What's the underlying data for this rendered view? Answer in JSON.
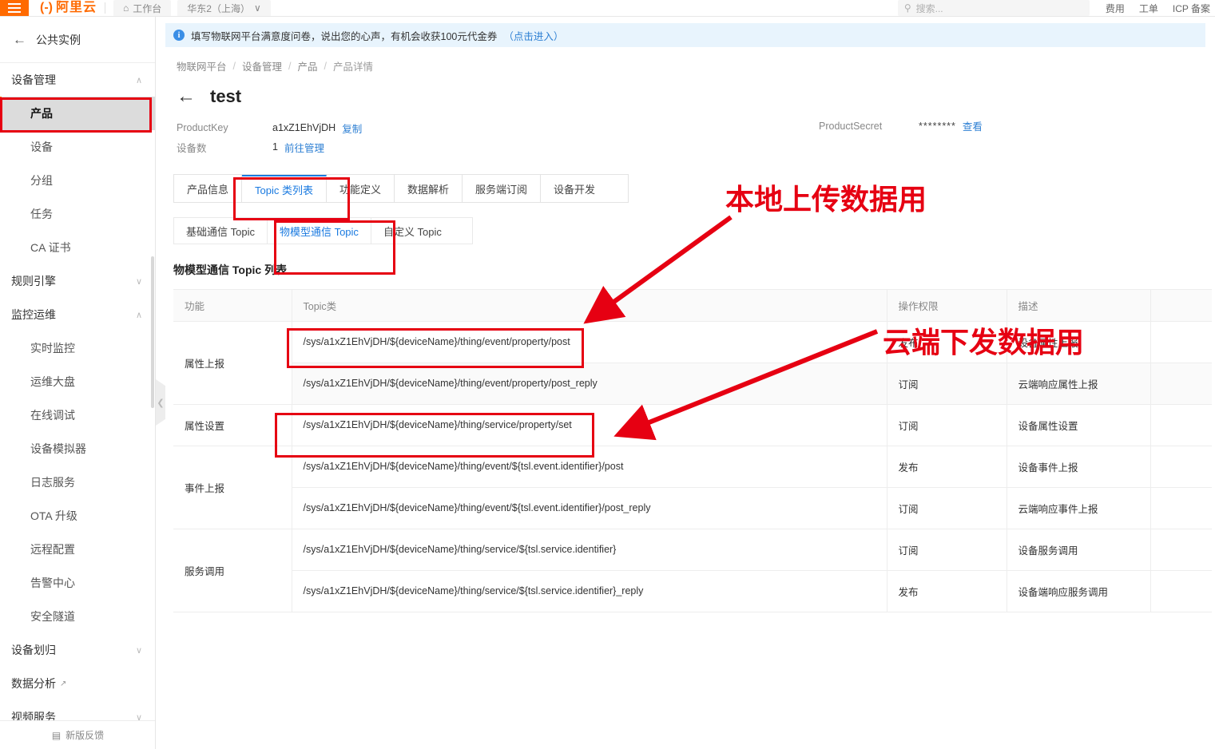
{
  "topbar": {
    "menu_icon": "hamburger-icon",
    "brand": "阿里云",
    "workbench_label": "工作台",
    "workbench_icon": "home-icon",
    "region_label": "华东2（上海）",
    "region_caret": "∨",
    "search_icon": "search-icon",
    "search_placeholder": "搜索...",
    "right_links": [
      "费用",
      "工单",
      "ICP 备案"
    ]
  },
  "sidebar": {
    "back_icon": "back-arrow-icon",
    "header_label": "公共实例",
    "groups": [
      {
        "label": "设备管理",
        "caret": "∧",
        "items": [
          {
            "label": "产品",
            "active": true
          },
          {
            "label": "设备",
            "active": false
          },
          {
            "label": "分组",
            "active": false
          },
          {
            "label": "任务",
            "active": false
          },
          {
            "label": "CA 证书",
            "active": false
          }
        ]
      },
      {
        "label": "规则引擎",
        "caret": "∨",
        "items": []
      },
      {
        "label": "监控运维",
        "caret": "∧",
        "items": [
          {
            "label": "实时监控",
            "active": false
          },
          {
            "label": "运维大盘",
            "active": false
          },
          {
            "label": "在线调试",
            "active": false
          },
          {
            "label": "设备模拟器",
            "active": false
          },
          {
            "label": "日志服务",
            "active": false
          },
          {
            "label": "OTA 升级",
            "active": false
          },
          {
            "label": "远程配置",
            "active": false
          },
          {
            "label": "告警中心",
            "active": false
          },
          {
            "label": "安全隧道",
            "active": false
          }
        ]
      },
      {
        "label": "设备划归",
        "caret": "∨",
        "items": []
      },
      {
        "label": "数据分析",
        "caret": "",
        "external": true,
        "items": []
      },
      {
        "label": "视频服务",
        "caret": "∨",
        "items": []
      }
    ],
    "footer_label": "新版反馈",
    "footer_icon": "feedback-icon",
    "collapse_icon": "chevron-left-icon"
  },
  "notice": {
    "icon": "info-circle-icon",
    "text": "填写物联网平台满意度问卷，说出您的心声，有机会收获100元代金券",
    "link": "（点击进入）"
  },
  "breadcrumb": {
    "items": [
      "物联网平台",
      "设备管理",
      "产品",
      "产品详情"
    ],
    "separator": "/"
  },
  "page": {
    "back_icon": "back-arrow-icon",
    "title": "test"
  },
  "product_meta": {
    "product_key_label": "ProductKey",
    "product_key_value": "a1xZ1EhVjDH",
    "copy_label": "复制",
    "device_count_label": "设备数",
    "device_count_value": "1",
    "manage_link": "前往管理",
    "product_secret_label": "ProductSecret",
    "product_secret_value": "********",
    "view_label": "查看"
  },
  "tabs": {
    "items": [
      {
        "label": "产品信息",
        "active": false
      },
      {
        "label": "Topic 类列表",
        "active": true
      },
      {
        "label": "功能定义",
        "active": false
      },
      {
        "label": "数据解析",
        "active": false
      },
      {
        "label": "服务端订阅",
        "active": false
      },
      {
        "label": "设备开发",
        "active": false
      }
    ]
  },
  "subtabs": {
    "items": [
      {
        "label": "基础通信 Topic",
        "active": false
      },
      {
        "label": "物模型通信 Topic",
        "active": true
      },
      {
        "label": "自定义 Topic",
        "active": false
      }
    ]
  },
  "section": {
    "title": "物模型通信 Topic 列表"
  },
  "table": {
    "headers": [
      "功能",
      "Topic类",
      "操作权限",
      "描述",
      ""
    ],
    "rows": [
      {
        "function": "属性上报",
        "function_rowspan": 2,
        "topic": "/sys/a1xZ1EhVjDH/${deviceName}/thing/event/property/post",
        "permission": "发布",
        "description": "设备属性上报",
        "alt": false
      },
      {
        "function": "",
        "function_rowspan": 0,
        "topic": "/sys/a1xZ1EhVjDH/${deviceName}/thing/event/property/post_reply",
        "permission": "订阅",
        "description": "云端响应属性上报",
        "alt": true
      },
      {
        "function": "属性设置",
        "function_rowspan": 1,
        "topic": "/sys/a1xZ1EhVjDH/${deviceName}/thing/service/property/set",
        "permission": "订阅",
        "description": "设备属性设置",
        "alt": false
      },
      {
        "function": "事件上报",
        "function_rowspan": 2,
        "topic": "/sys/a1xZ1EhVjDH/${deviceName}/thing/event/${tsl.event.identifier}/post",
        "permission": "发布",
        "description": "设备事件上报",
        "alt": false
      },
      {
        "function": "",
        "function_rowspan": 0,
        "topic": "/sys/a1xZ1EhVjDH/${deviceName}/thing/event/${tsl.event.identifier}/post_reply",
        "permission": "订阅",
        "description": "云端响应事件上报",
        "alt": false
      },
      {
        "function": "服务调用",
        "function_rowspan": 2,
        "topic": "/sys/a1xZ1EhVjDH/${deviceName}/thing/service/${tsl.service.identifier}",
        "permission": "订阅",
        "description": "设备服务调用",
        "alt": false
      },
      {
        "function": "",
        "function_rowspan": 0,
        "topic": "/sys/a1xZ1EhVjDH/${deviceName}/thing/service/${tsl.service.identifier}_reply",
        "permission": "发布",
        "description": "设备端响应服务调用",
        "alt": false
      }
    ]
  },
  "annotations": {
    "color": "#e60012",
    "labels": [
      {
        "id": "upload-note",
        "text": "本地上传数据用"
      },
      {
        "id": "downlink-note",
        "text": "云端下发数据用"
      }
    ]
  }
}
